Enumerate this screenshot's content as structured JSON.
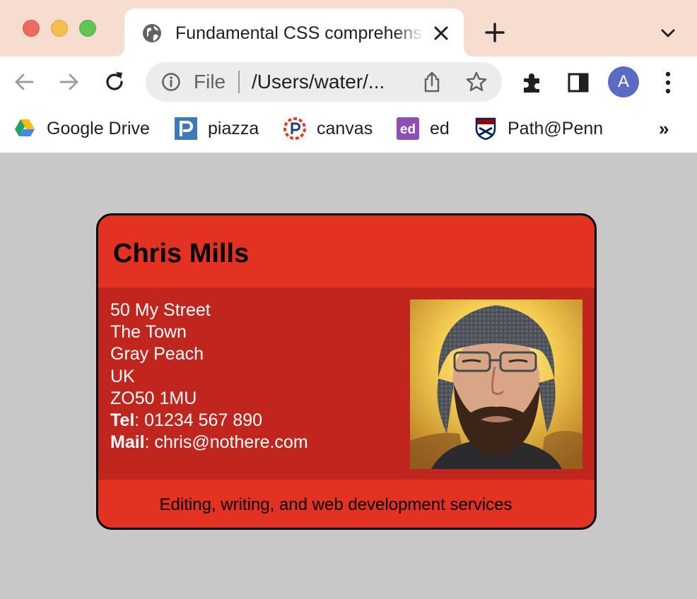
{
  "window": {
    "controls": [
      "close",
      "minimize",
      "maximize"
    ]
  },
  "tab": {
    "title": "Fundamental CSS comprehension",
    "favicon": "globe-icon",
    "close_icon": "close-icon"
  },
  "tabstrip": {
    "new_tab_icon": "plus-icon",
    "tab_search_icon": "chevron-down-icon"
  },
  "toolbar": {
    "back_icon": "arrow-left-icon",
    "forward_icon": "arrow-right-icon",
    "reload_icon": "reload-icon",
    "omnibox": {
      "info_icon": "info-icon",
      "scheme": "File",
      "url": "/Users/water/..."
    },
    "share_icon": "share-icon",
    "bookmark_star_icon": "star-icon",
    "extensions_icon": "puzzle-icon",
    "side_panel_icon": "side-panel-icon",
    "profile_initial": "A",
    "menu_icon": "kebab-icon"
  },
  "bookmarks": [
    {
      "label": "Google Drive",
      "icon": "google-drive-icon"
    },
    {
      "label": "piazza",
      "icon": "piazza-icon"
    },
    {
      "label": "canvas",
      "icon": "canvas-icon"
    },
    {
      "label": "ed",
      "icon": "ed-icon",
      "icon_text": "ed"
    },
    {
      "label": "Path@Penn",
      "icon": "penn-shield-icon"
    }
  ],
  "bookmarks_overflow": "»",
  "card": {
    "name": "Chris Mills",
    "address": [
      "50 My Street",
      "The Town",
      "Gray Peach",
      "UK",
      "ZO50 1MU"
    ],
    "tel_label": "Tel",
    "tel_value": "01234 567 890",
    "mail_label": "Mail",
    "mail_value": "chris@nothere.com",
    "tagline": "Editing, writing, and web development services",
    "photo": "profile-photo"
  },
  "colors": {
    "page_background": "#c8c8c8",
    "card_header": "#e33122",
    "card_body": "#c0261e",
    "titlebar": "#f6ddd0",
    "avatar": "#5a6bc4"
  }
}
